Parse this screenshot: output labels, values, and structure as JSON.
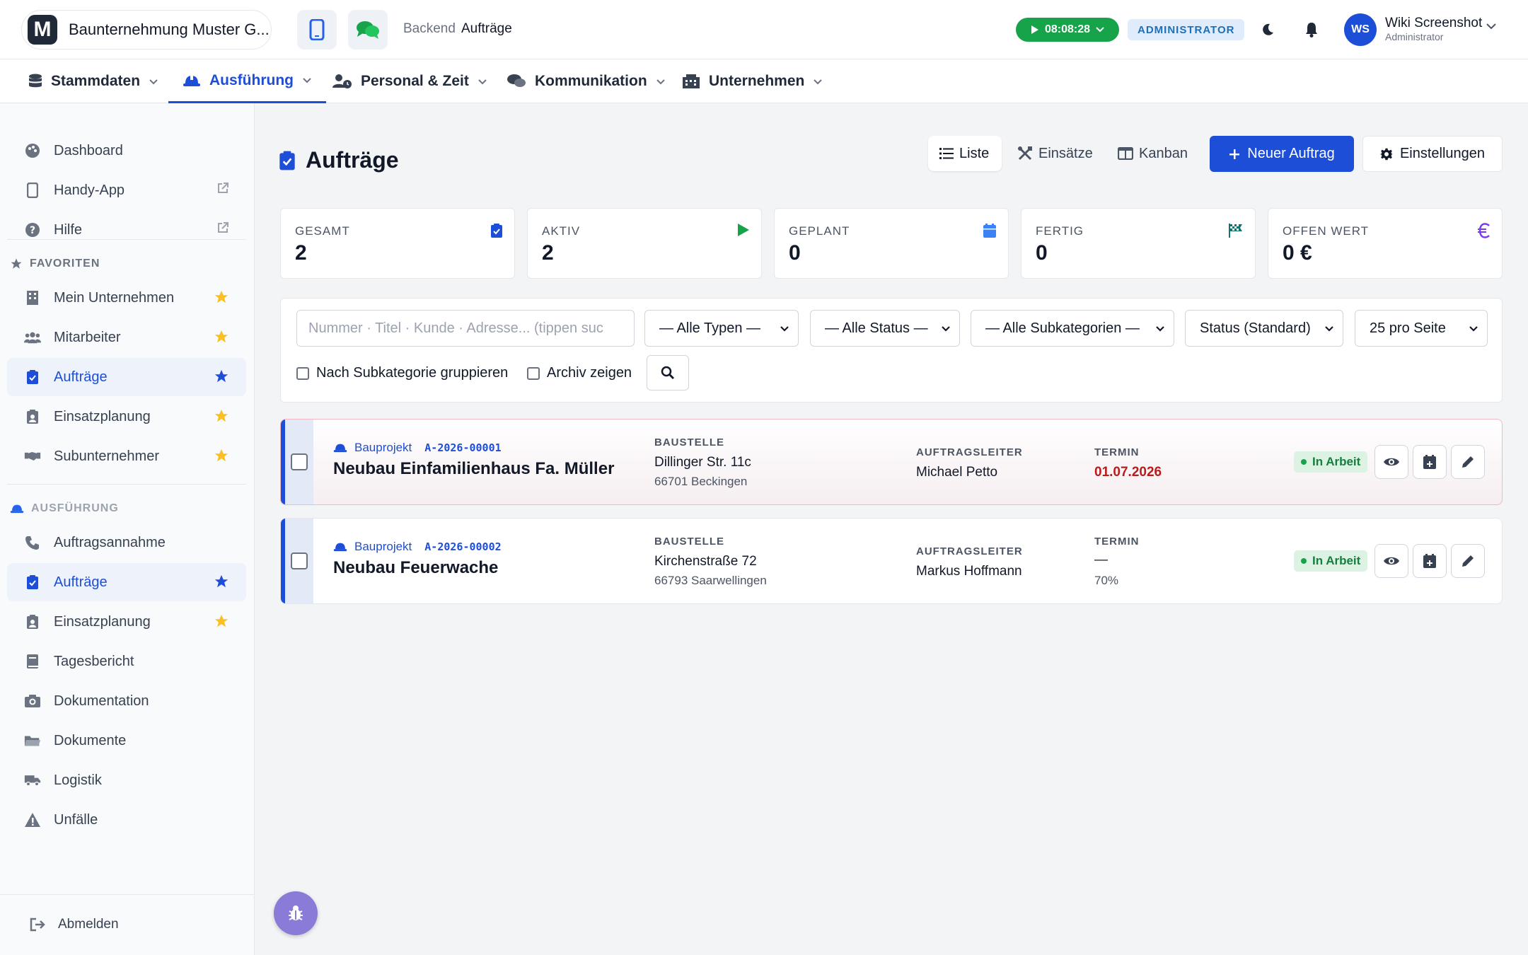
{
  "header": {
    "company": "Baunternehmung Muster G...",
    "logo_letter": "M",
    "breadcrumb_root": "Backend",
    "breadcrumb_current": "Aufträge",
    "timer": "08:08:28",
    "role_badge": "ADMINISTRATOR",
    "user_initials": "WS",
    "user_name": "Wiki Screenshot",
    "user_role": "Administrator"
  },
  "nav": [
    {
      "label": "Stammdaten",
      "icon": "database-icon"
    },
    {
      "label": "Ausführung",
      "icon": "hardhat-icon"
    },
    {
      "label": "Personal & Zeit",
      "icon": "user-clock-icon"
    },
    {
      "label": "Kommunikation",
      "icon": "chat-icon"
    },
    {
      "label": "Unternehmen",
      "icon": "building-icon"
    }
  ],
  "sidebar": {
    "top": [
      {
        "label": "Dashboard",
        "icon": "palette-icon"
      },
      {
        "label": "Handy-App",
        "icon": "mobile-icon"
      },
      {
        "label": "Hilfe",
        "icon": "question-icon"
      }
    ],
    "favorites_title": "FAVORITEN",
    "favorites": [
      {
        "label": "Mein Unternehmen",
        "icon": "building-icon"
      },
      {
        "label": "Mitarbeiter",
        "icon": "users-icon"
      },
      {
        "label": "Aufträge",
        "icon": "clipboard-check-icon"
      },
      {
        "label": "Einsatzplanung",
        "icon": "clipboard-user-icon"
      },
      {
        "label": "Subunternehmer",
        "icon": "handshake-icon"
      }
    ],
    "execution_title": "AUSFÜHRUNG",
    "execution": [
      {
        "label": "Auftragsannahme",
        "icon": "phone-icon"
      },
      {
        "label": "Aufträge",
        "icon": "clipboard-check-icon"
      },
      {
        "label": "Einsatzplanung",
        "icon": "clipboard-user-icon"
      },
      {
        "label": "Tagesbericht",
        "icon": "book-icon"
      },
      {
        "label": "Dokumentation",
        "icon": "camera-icon"
      },
      {
        "label": "Dokumente",
        "icon": "folder-icon"
      },
      {
        "label": "Logistik",
        "icon": "truck-icon"
      },
      {
        "label": "Unfälle",
        "icon": "warning-icon"
      }
    ],
    "logout": "Abmelden"
  },
  "page": {
    "title": "Aufträge",
    "views": [
      "Liste",
      "Einsätze",
      "Kanban"
    ],
    "new_button": "Neuer Auftrag",
    "settings_button": "Einstellungen"
  },
  "stats": [
    {
      "label": "GESAMT",
      "value": "2",
      "icon": "clipboard-check-icon",
      "color": "#1d4ed8"
    },
    {
      "label": "AKTIV",
      "value": "2",
      "icon": "play-icon",
      "color": "#16a34a"
    },
    {
      "label": "GEPLANT",
      "value": "0",
      "icon": "calendar-icon",
      "color": "#3b82f6"
    },
    {
      "label": "FERTIG",
      "value": "0",
      "icon": "flag-checkered-icon",
      "color": "#0f766e"
    },
    {
      "label": "OFFEN WERT",
      "value": "0 €",
      "icon": "euro-icon",
      "color": "#7c3aed"
    }
  ],
  "filters": {
    "search_placeholder": "Nummer · Titel · Kunde · Adresse... (tippen suc",
    "type": "— Alle Typen —",
    "status": "— Alle Status —",
    "subcat": "— Alle Subkategorien —",
    "sort": "Status (Standard)",
    "per_page": "25 pro Seite",
    "group_label": "Nach Subkategorie gruppieren",
    "archive_label": "Archiv zeigen"
  },
  "orders": [
    {
      "type": "Bauprojekt",
      "number": "A-2026-00001",
      "title": "Neubau Einfamilienhaus Fa. Müller",
      "site_label": "BAUSTELLE",
      "street": "Dillinger Str. 11c",
      "city": "66701 Beckingen",
      "lead_label": "AUFTRAGSLEITER",
      "lead": "Michael Petto",
      "date_label": "TERMIN",
      "date": "01.07.2026",
      "progress": "",
      "status": "In Arbeit"
    },
    {
      "type": "Bauprojekt",
      "number": "A-2026-00002",
      "title": "Neubau Feuerwache",
      "site_label": "BAUSTELLE",
      "street": "Kirchenstraße 72",
      "city": "66793 Saarwellingen",
      "lead_label": "AUFTRAGSLEITER",
      "lead": "Markus Hoffmann",
      "date_label": "TERMIN",
      "date": "—",
      "progress": "70%",
      "status": "In Arbeit"
    }
  ]
}
